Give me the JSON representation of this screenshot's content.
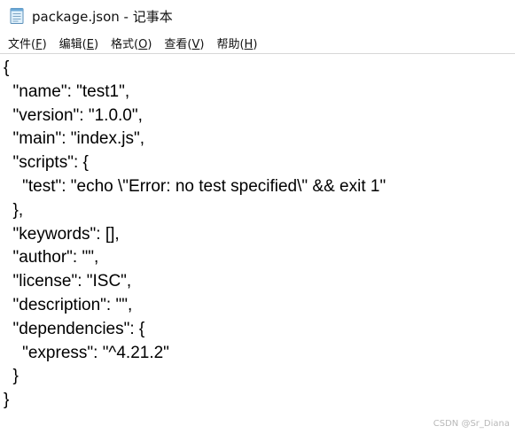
{
  "window": {
    "title": "package.json - 记事本",
    "icon": "notepad-icon"
  },
  "menubar": {
    "items": [
      {
        "label": "文件(",
        "mnemonic": "F",
        "suffix": ")"
      },
      {
        "label": "编辑(",
        "mnemonic": "E",
        "suffix": ")"
      },
      {
        "label": "格式(",
        "mnemonic": "O",
        "suffix": ")"
      },
      {
        "label": "查看(",
        "mnemonic": "V",
        "suffix": ")"
      },
      {
        "label": "帮助(",
        "mnemonic": "H",
        "suffix": ")"
      }
    ]
  },
  "editor": {
    "lines": [
      "{",
      "  \"name\": \"test1\",",
      "  \"version\": \"1.0.0\",",
      "  \"main\": \"index.js\",",
      "  \"scripts\": {",
      "    \"test\": \"echo \\\"Error: no test specified\\\" && exit 1\"",
      "  },",
      "  \"keywords\": [],",
      "  \"author\": \"\",",
      "  \"license\": \"ISC\",",
      "  \"description\": \"\",",
      "  \"dependencies\": {",
      "    \"express\": \"^4.21.2\"",
      "  }",
      "}"
    ]
  },
  "watermark": "CSDN @Sr_Diana"
}
